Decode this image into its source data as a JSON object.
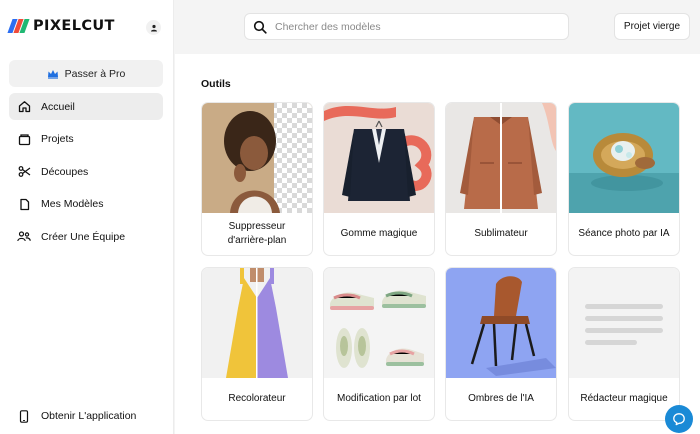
{
  "brand": {
    "name": "PIXELCUT",
    "logo_colors": [
      "#2b6ef2",
      "#f04b3a",
      "#1fb873"
    ]
  },
  "sidebar": {
    "pro_button": {
      "label": "Passer à Pro",
      "icon": "crown-icon"
    },
    "items": [
      {
        "label": "Accueil",
        "icon": "home-icon",
        "active": true
      },
      {
        "label": "Projets",
        "icon": "folder-icon",
        "active": false
      },
      {
        "label": "Découpes",
        "icon": "scissors-icon",
        "active": false
      },
      {
        "label": "Mes Modèles",
        "icon": "file-icon",
        "active": false
      },
      {
        "label": "Créer Une Équipe",
        "icon": "team-icon",
        "active": false
      }
    ],
    "get_app": {
      "label": "Obtenir L'application",
      "icon": "phone-icon"
    }
  },
  "topbar": {
    "search": {
      "placeholder": "Chercher des modèles",
      "value": ""
    },
    "new_project_label": "Projet vierge"
  },
  "main": {
    "section_title": "Outils",
    "tools": [
      {
        "label": "Suppresseur d'arrière-plan"
      },
      {
        "label": "Gomme magique"
      },
      {
        "label": "Sublimateur"
      },
      {
        "label": "Séance photo par IA"
      },
      {
        "label": "Recolorateur"
      },
      {
        "label": "Modification par lot"
      },
      {
        "label": "Ombres de l'IA"
      },
      {
        "label": "Rédacteur magique"
      }
    ]
  },
  "colors": {
    "accent": "#1a8ad6",
    "pro_crown": "#1f6fe0"
  }
}
